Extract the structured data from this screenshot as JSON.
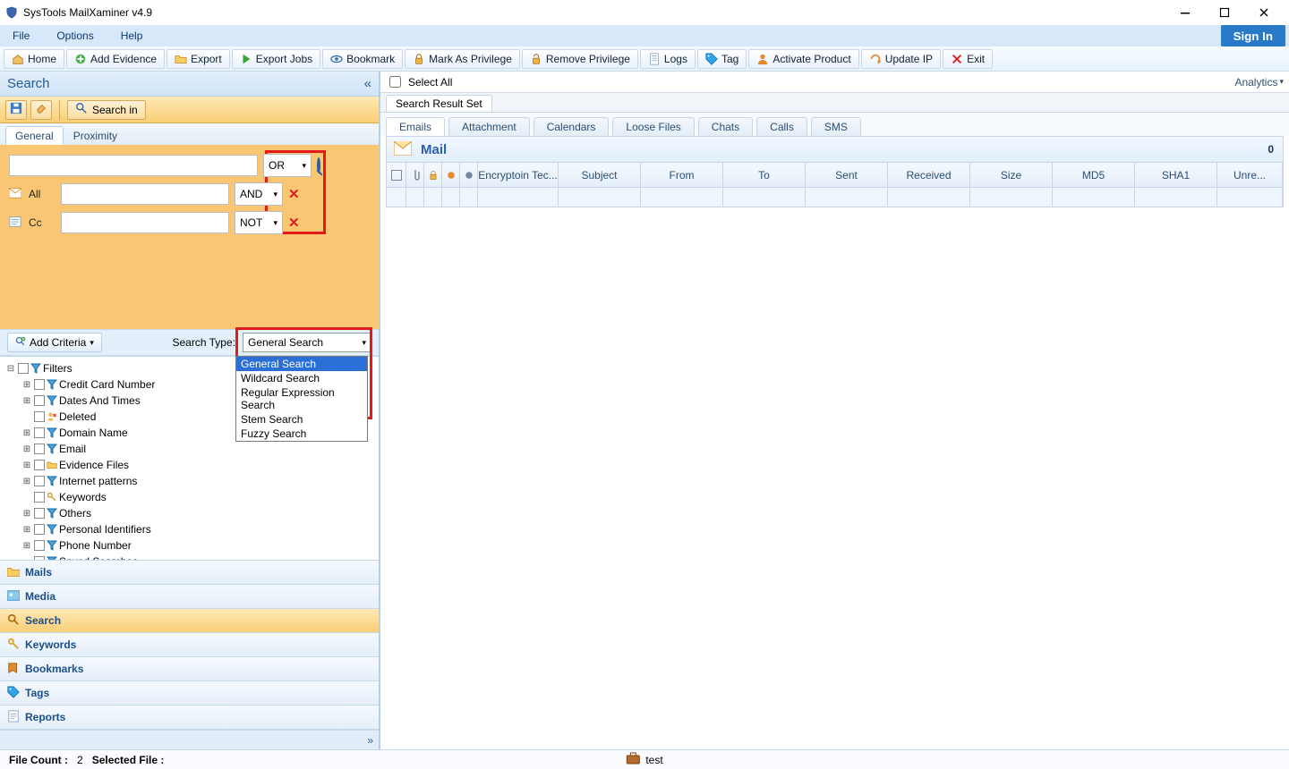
{
  "window": {
    "title": "SysTools MailXaminer v4.9"
  },
  "menu": {
    "file": "File",
    "options": "Options",
    "help": "Help",
    "signin": "Sign In"
  },
  "toolbar": {
    "home": "Home",
    "add_evidence": "Add Evidence",
    "export": "Export",
    "export_jobs": "Export Jobs",
    "bookmark": "Bookmark",
    "mark_priv": "Mark As Privilege",
    "remove_priv": "Remove Privilege",
    "logs": "Logs",
    "tag": "Tag",
    "activate": "Activate Product",
    "update_ip": "Update IP",
    "exit": "Exit"
  },
  "search_panel": {
    "title": "Search",
    "search_in": "Search in",
    "tabs": {
      "general": "General",
      "proximity": "Proximity"
    },
    "ops": {
      "or": "OR",
      "and": "AND",
      "not": "NOT"
    },
    "fields": {
      "all": "All",
      "cc": "Cc"
    },
    "add_criteria": "Add Criteria",
    "search_type_label": "Search Type:",
    "search_type_value": "General Search",
    "search_type_options": [
      "General Search",
      "Wildcard Search",
      "Regular Expression Search",
      "Stem Search",
      "Fuzzy Search"
    ]
  },
  "filters": {
    "root": "Filters",
    "items": [
      "Credit Card Number",
      "Dates And Times",
      "Deleted",
      "Domain Name",
      "Email",
      "Evidence Files",
      "Internet patterns",
      "Keywords",
      "Others",
      "Personal Identifiers",
      "Phone Number",
      "Saved Searches"
    ]
  },
  "nav": {
    "mails": "Mails",
    "media": "Media",
    "search": "Search",
    "keywords": "Keywords",
    "bookmarks": "Bookmarks",
    "tags": "Tags",
    "reports": "Reports"
  },
  "right": {
    "select_all": "Select All",
    "analytics": "Analytics",
    "result_tab": "Search Result Set",
    "type_tabs": [
      "Emails",
      "Attachment",
      "Calendars",
      "Loose Files",
      "Chats",
      "Calls",
      "SMS"
    ],
    "mail_title": "Mail",
    "mail_count": "0",
    "columns": [
      "Encryptoin Tec...",
      "Subject",
      "From",
      "To",
      "Sent",
      "Received",
      "Size",
      "MD5",
      "SHA1",
      "Unre..."
    ]
  },
  "status": {
    "file_count_label": "File Count :",
    "file_count": "2",
    "selected_label": "Selected File :",
    "case": "test"
  }
}
